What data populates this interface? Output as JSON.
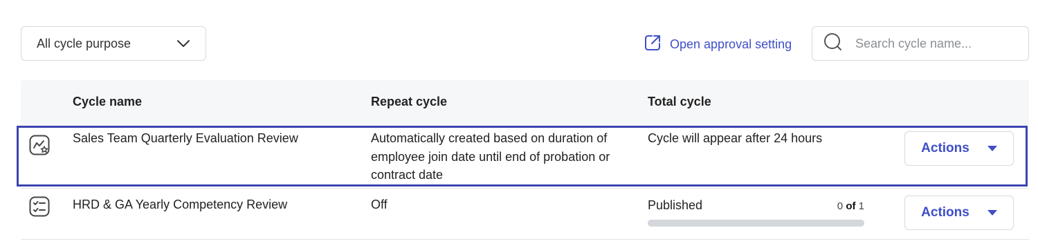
{
  "filter": {
    "selected": "All cycle purpose",
    "icon": "chevron-down-icon"
  },
  "approval_link": {
    "label": "Open approval setting",
    "icon": "external-link-icon"
  },
  "search": {
    "placeholder": "Search cycle name...",
    "value": "",
    "icon": "search-icon"
  },
  "table": {
    "columns": [
      "Cycle name",
      "Repeat cycle",
      "Total cycle"
    ],
    "rows": [
      {
        "icon": "review-star-icon",
        "name": "Sales Team Quarterly Evaluation Review",
        "repeat": "Automatically created based on duration of employee join date until end of probation or contract date",
        "total": "Cycle will appear after 24 hours",
        "action_label": "Actions",
        "selected": true
      },
      {
        "icon": "checklist-icon",
        "name": "HRD & GA Yearly Competency Review",
        "repeat": "Off",
        "total_status": "Published",
        "progress_done": "0",
        "progress_of": "of",
        "progress_total": "1",
        "progress_fraction": 0,
        "action_label": "Actions",
        "selected": false
      }
    ]
  },
  "colors": {
    "accent": "#3e4fc6",
    "selection_border": "#3b44b0",
    "header_bg": "#f6f7f9",
    "progress_track": "#d3d6db"
  }
}
